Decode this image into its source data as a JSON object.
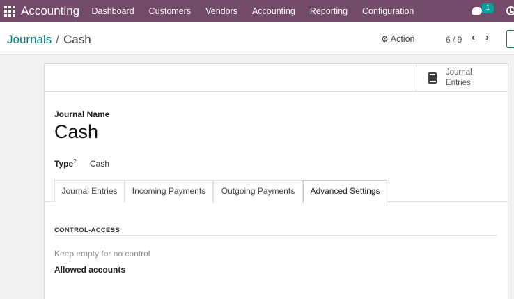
{
  "navbar": {
    "app_title": "Accounting",
    "menu": [
      "Dashboard",
      "Customers",
      "Vendors",
      "Accounting",
      "Reporting",
      "Configuration"
    ],
    "chat_badge": "1",
    "brand_color": "#714b67"
  },
  "control_panel": {
    "breadcrumb_parent": "Journals",
    "breadcrumb_separator": "/",
    "breadcrumb_current": "Cash",
    "action_label": "Action",
    "pager": "6 / 9",
    "prev_icon": "‹",
    "next_icon": "›"
  },
  "form": {
    "stat_button_label": "Journal Entries",
    "journal_name_label": "Journal Name",
    "journal_name": "Cash",
    "type_label": "Type",
    "type_help": "?",
    "type_value": "Cash",
    "tabs": [
      "Journal Entries",
      "Incoming Payments",
      "Outgoing Payments",
      "Advanced Settings"
    ],
    "active_tab": "Advanced Settings",
    "section_title": "CONTROL-ACCESS",
    "placeholder_hint": "Keep empty for no control",
    "allowed_accounts_label": "Allowed accounts"
  }
}
